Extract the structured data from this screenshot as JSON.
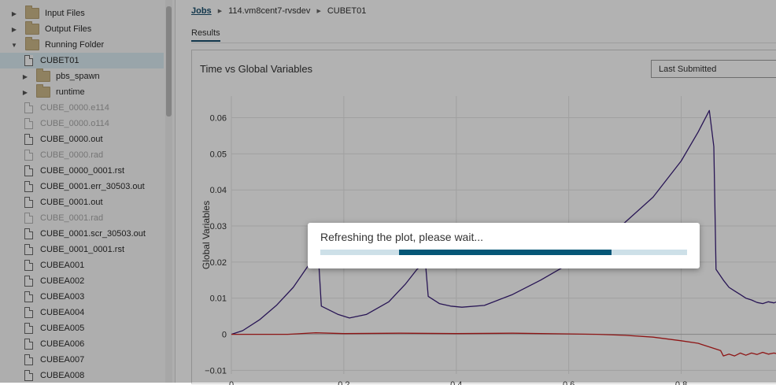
{
  "sidebar": {
    "items": [
      {
        "label": "Input Files",
        "kind": "folder",
        "arrow": "▶",
        "indent": 0,
        "dim": false,
        "selected": false
      },
      {
        "label": "Output Files",
        "kind": "folder",
        "arrow": "▶",
        "indent": 0,
        "dim": false,
        "selected": false
      },
      {
        "label": "Running Folder",
        "kind": "folder",
        "arrow": "▼",
        "indent": 0,
        "dim": false,
        "selected": false
      },
      {
        "label": "CUBET01",
        "kind": "file",
        "arrow": "",
        "indent": 1,
        "dim": false,
        "selected": true
      },
      {
        "label": "pbs_spawn",
        "kind": "folder",
        "arrow": "▶",
        "indent": 1,
        "dim": false,
        "selected": false
      },
      {
        "label": "runtime",
        "kind": "folder",
        "arrow": "▶",
        "indent": 1,
        "dim": false,
        "selected": false
      },
      {
        "label": "CUBE_0000.e114",
        "kind": "file",
        "arrow": "",
        "indent": 1,
        "dim": true,
        "selected": false
      },
      {
        "label": "CUBE_0000.o114",
        "kind": "file",
        "arrow": "",
        "indent": 1,
        "dim": true,
        "selected": false
      },
      {
        "label": "CUBE_0000.out",
        "kind": "file",
        "arrow": "",
        "indent": 1,
        "dim": false,
        "selected": false
      },
      {
        "label": "CUBE_0000.rad",
        "kind": "file",
        "arrow": "",
        "indent": 1,
        "dim": true,
        "selected": false
      },
      {
        "label": "CUBE_0000_0001.rst",
        "kind": "file",
        "arrow": "",
        "indent": 1,
        "dim": false,
        "selected": false
      },
      {
        "label": "CUBE_0001.err_30503.out",
        "kind": "file",
        "arrow": "",
        "indent": 1,
        "dim": false,
        "selected": false
      },
      {
        "label": "CUBE_0001.out",
        "kind": "file",
        "arrow": "",
        "indent": 1,
        "dim": false,
        "selected": false
      },
      {
        "label": "CUBE_0001.rad",
        "kind": "file",
        "arrow": "",
        "indent": 1,
        "dim": true,
        "selected": false
      },
      {
        "label": "CUBE_0001.scr_30503.out",
        "kind": "file",
        "arrow": "",
        "indent": 1,
        "dim": false,
        "selected": false
      },
      {
        "label": "CUBE_0001_0001.rst",
        "kind": "file",
        "arrow": "",
        "indent": 1,
        "dim": false,
        "selected": false
      },
      {
        "label": "CUBEA001",
        "kind": "file",
        "arrow": "",
        "indent": 1,
        "dim": false,
        "selected": false
      },
      {
        "label": "CUBEA002",
        "kind": "file",
        "arrow": "",
        "indent": 1,
        "dim": false,
        "selected": false
      },
      {
        "label": "CUBEA003",
        "kind": "file",
        "arrow": "",
        "indent": 1,
        "dim": false,
        "selected": false
      },
      {
        "label": "CUBEA004",
        "kind": "file",
        "arrow": "",
        "indent": 1,
        "dim": false,
        "selected": false
      },
      {
        "label": "CUBEA005",
        "kind": "file",
        "arrow": "",
        "indent": 1,
        "dim": false,
        "selected": false
      },
      {
        "label": "CUBEA006",
        "kind": "file",
        "arrow": "",
        "indent": 1,
        "dim": false,
        "selected": false
      },
      {
        "label": "CUBEA007",
        "kind": "file",
        "arrow": "",
        "indent": 1,
        "dim": false,
        "selected": false
      },
      {
        "label": "CUBEA008",
        "kind": "file",
        "arrow": "",
        "indent": 1,
        "dim": false,
        "selected": false
      }
    ]
  },
  "breadcrumb": {
    "root": "Jobs",
    "job": "114.vm8cent7-rvsdev",
    "current": "CUBET01"
  },
  "tabs": {
    "results": "Results"
  },
  "plot": {
    "title": "Time vs Global Variables",
    "select_value": "Last Submitted"
  },
  "colors": {
    "accent": "#1a4f6e",
    "progress": "#055777",
    "series_purple": "#3a1f7a",
    "series_red": "#cc1f1f"
  },
  "chart_data": {
    "type": "line",
    "title": "Time vs Global Variables",
    "xlabel": "",
    "ylabel": "Global Variables",
    "xlim": [
      0,
      0.97
    ],
    "ylim": [
      -0.011,
      0.066
    ],
    "x_ticks": [
      0,
      0.2,
      0.4,
      0.6,
      0.8
    ],
    "x_tick_labels": [
      "0",
      "0.2",
      "0.4",
      "0.6",
      "0.8"
    ],
    "y_ticks": [
      -0.01,
      0,
      0.01,
      0.02,
      0.03,
      0.04,
      0.05,
      0.06
    ],
    "y_tick_labels": [
      "−0.01",
      "0",
      "0.01",
      "0.02",
      "0.03",
      "0.04",
      "0.05",
      "0.06"
    ],
    "grid": true,
    "series": [
      {
        "color": "#3a1f7a",
        "x": [
          0,
          0.02,
          0.05,
          0.08,
          0.11,
          0.13,
          0.15,
          0.155,
          0.16,
          0.19,
          0.21,
          0.24,
          0.28,
          0.31,
          0.33,
          0.345,
          0.35,
          0.37,
          0.39,
          0.41,
          0.45,
          0.5,
          0.55,
          0.6,
          0.65,
          0.7,
          0.75,
          0.8,
          0.83,
          0.85,
          0.858,
          0.862,
          0.875,
          0.885,
          0.895,
          0.905,
          0.915,
          0.925,
          0.935,
          0.945,
          0.955,
          0.965,
          0.97
        ],
        "y": [
          0,
          0.001,
          0.004,
          0.008,
          0.013,
          0.0175,
          0.022,
          0.021,
          0.0078,
          0.0055,
          0.0045,
          0.0055,
          0.009,
          0.014,
          0.018,
          0.02,
          0.0105,
          0.0085,
          0.0078,
          0.0075,
          0.008,
          0.011,
          0.015,
          0.0195,
          0.025,
          0.031,
          0.038,
          0.048,
          0.056,
          0.062,
          0.052,
          0.018,
          0.015,
          0.013,
          0.012,
          0.011,
          0.01,
          0.0095,
          0.0088,
          0.0085,
          0.009,
          0.0087,
          0.009
        ]
      },
      {
        "color": "#cc1f1f",
        "x": [
          0,
          0.1,
          0.15,
          0.2,
          0.3,
          0.4,
          0.5,
          0.6,
          0.65,
          0.7,
          0.75,
          0.8,
          0.83,
          0.85,
          0.87,
          0.875,
          0.885,
          0.895,
          0.905,
          0.915,
          0.925,
          0.935,
          0.945,
          0.955,
          0.965,
          0.97
        ],
        "y": [
          0,
          0,
          0.0004,
          0.0002,
          0.0003,
          0.0002,
          0.0003,
          0.0001,
          0,
          -0.0003,
          -0.0008,
          -0.0018,
          -0.0025,
          -0.0035,
          -0.0045,
          -0.006,
          -0.0055,
          -0.006,
          -0.0052,
          -0.0058,
          -0.0052,
          -0.0056,
          -0.005,
          -0.0055,
          -0.0052,
          -0.0054
        ]
      }
    ]
  },
  "loading": {
    "message": "Refreshing the plot, please wait...",
    "progress_start": 0.215,
    "progress_end": 0.795
  }
}
